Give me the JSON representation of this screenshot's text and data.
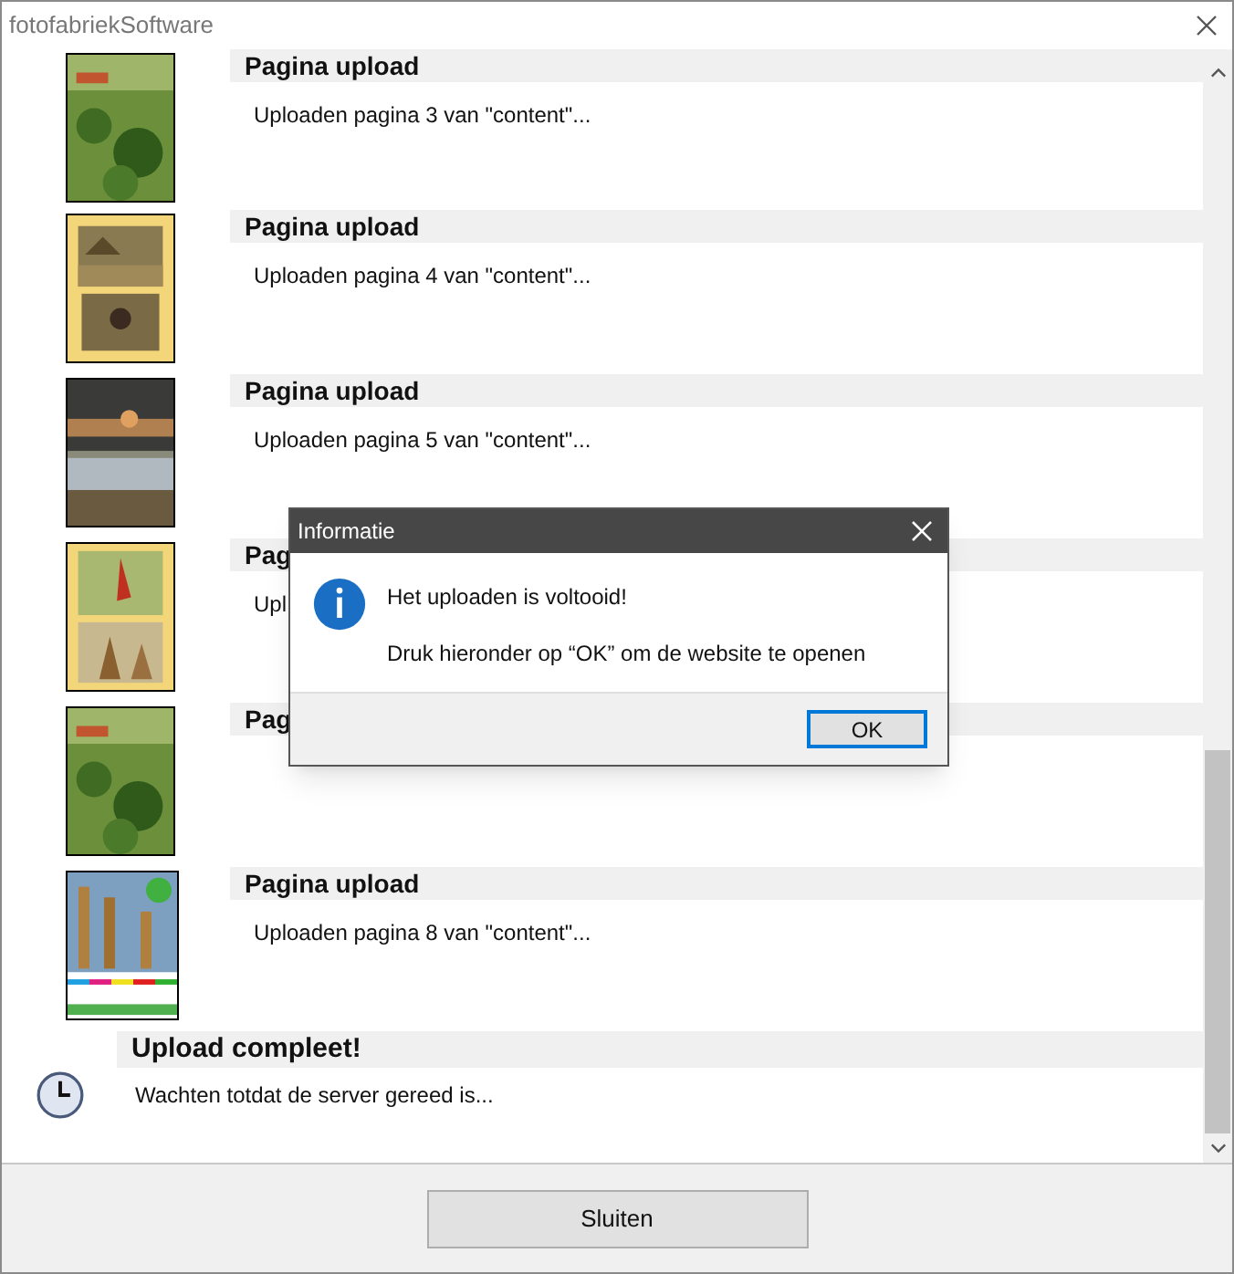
{
  "window": {
    "title": "fotofabriekSoftware"
  },
  "uploads": [
    {
      "kind": "page",
      "heading": "Pagina upload",
      "text": "Uploaden pagina 3 van \"content\"..."
    },
    {
      "kind": "page",
      "heading": "Pagina upload",
      "text": "Uploaden pagina 4 van \"content\"..."
    },
    {
      "kind": "page",
      "heading": "Pagina upload",
      "text": "Uploaden pagina 5 van \"content\"..."
    },
    {
      "kind": "page",
      "heading": "Pag",
      "text": "Upl"
    },
    {
      "kind": "page",
      "heading": "Pag"
    },
    {
      "kind": "page",
      "heading": "Pagina upload",
      "text": "Uploaden pagina 8 van \"content\"..."
    },
    {
      "kind": "done",
      "heading": "Upload compleet!",
      "text": "Wachten totdat de server gereed is..."
    }
  ],
  "dialog": {
    "title": "Informatie",
    "message": "Het uploaden is voltooid!",
    "detail": "Druk hieronder op “OK” om de website te openen",
    "buttons": [
      {
        "label": "OK",
        "selected": true
      }
    ]
  },
  "footer": {
    "close_button": "Sluiten"
  }
}
